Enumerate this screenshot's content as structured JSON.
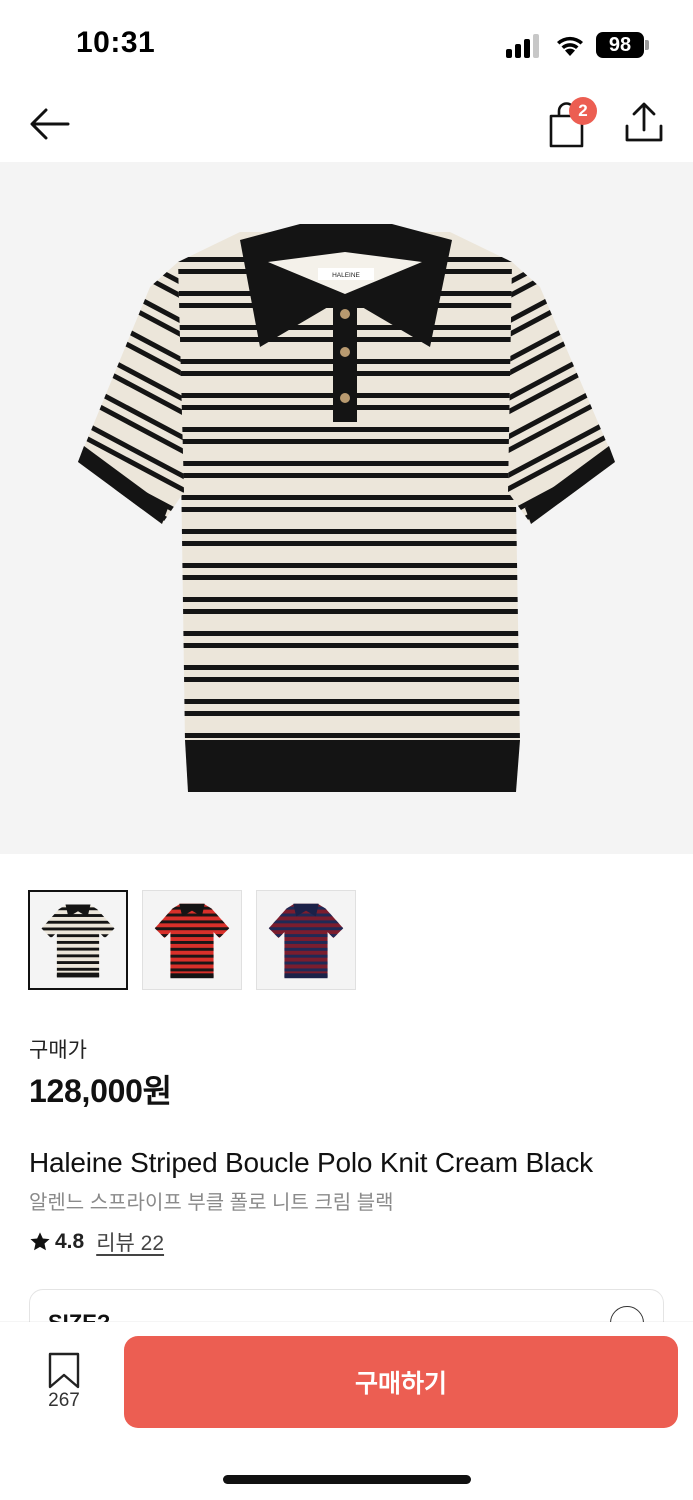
{
  "status_bar": {
    "time": "10:31",
    "battery": "98"
  },
  "nav": {
    "back_icon": "arrow-left-icon",
    "bag_icon": "shopping-bag-icon",
    "bag_count": "2",
    "share_icon": "share-icon"
  },
  "product": {
    "price_label": "구매가",
    "price": "128,000원",
    "name_en": "Haleine Striped Boucle Polo Knit Cream Black",
    "name_ko": "알렌느 스프라이프 부클 폴로 니트 크림 블랙",
    "rating": "4.8",
    "review_link": "리뷰 22",
    "brand_tag": "HALEINE"
  },
  "thumbnails": [
    {
      "color": "cream-black",
      "stripe_a": "#ece6da",
      "stripe_b": "#141414",
      "collar": "#141414",
      "selected": true
    },
    {
      "color": "red-black",
      "stripe_a": "#d8302a",
      "stripe_b": "#1a1616",
      "collar": "#141414",
      "selected": false
    },
    {
      "color": "navy-burgundy",
      "stripe_a": "#7b1d2e",
      "stripe_b": "#1f2a56",
      "collar": "#1b2148",
      "selected": false
    }
  ],
  "size_selector": {
    "label": "SIZE?"
  },
  "bottom_bar": {
    "wish_count": "267",
    "buy_label": "구매하기"
  },
  "colors": {
    "accent": "#ec5e52",
    "badge": "#ec5e52",
    "hero_bg": "#f4f4f4"
  }
}
